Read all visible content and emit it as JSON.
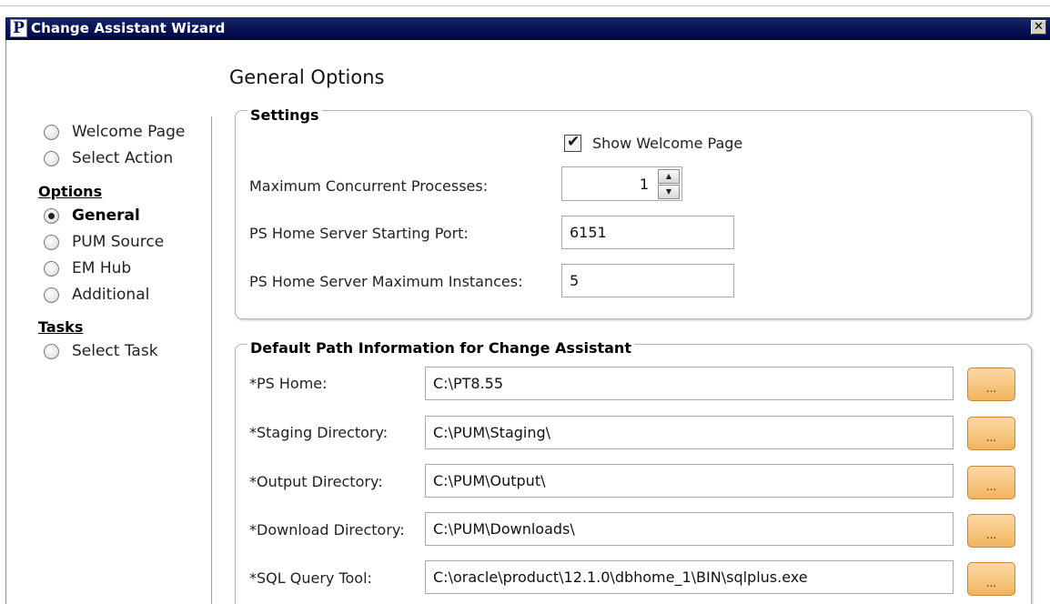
{
  "window": {
    "title": "Change Assistant Wizard",
    "app_icon_letter": "P",
    "close_glyph": "✕"
  },
  "page_title": "General Options",
  "nav": {
    "items_top": [
      {
        "label": "Welcome Page",
        "selected": false
      },
      {
        "label": "Select Action",
        "selected": false
      }
    ],
    "options_heading": "Options",
    "options_items": [
      {
        "label": "General",
        "selected": true
      },
      {
        "label": "PUM Source",
        "selected": false
      },
      {
        "label": "EM Hub",
        "selected": false
      },
      {
        "label": "Additional",
        "selected": false
      }
    ],
    "tasks_heading": "Tasks",
    "tasks_items": [
      {
        "label": "Select Task",
        "selected": false
      }
    ]
  },
  "settings": {
    "title": "Settings",
    "show_welcome_label": "Show Welcome Page",
    "show_welcome_checked": true,
    "max_processes_label": "Maximum Concurrent Processes:",
    "max_processes_value": "1",
    "start_port_label": "PS Home Server Starting Port:",
    "start_port_value": "6151",
    "max_instances_label": "PS Home Server Maximum Instances:",
    "max_instances_value": "5"
  },
  "paths": {
    "title": "Default Path Information for Change Assistant",
    "browse_label": "...",
    "rows": [
      {
        "label": "*PS Home:",
        "value": "C:\\PT8.55"
      },
      {
        "label": "*Staging Directory:",
        "value": "C:\\PUM\\Staging\\"
      },
      {
        "label": "*Output Directory:",
        "value": "C:\\PUM\\Output\\"
      },
      {
        "label": "*Download Directory:",
        "value": "C:\\PUM\\Downloads\\"
      },
      {
        "label": "*SQL Query Tool:",
        "value": "C:\\oracle\\product\\12.1.0\\dbhome_1\\BIN\\sqlplus.exe"
      }
    ]
  },
  "colors": {
    "titlebar": "#0a1456",
    "browse_button": "#f2b45e"
  }
}
